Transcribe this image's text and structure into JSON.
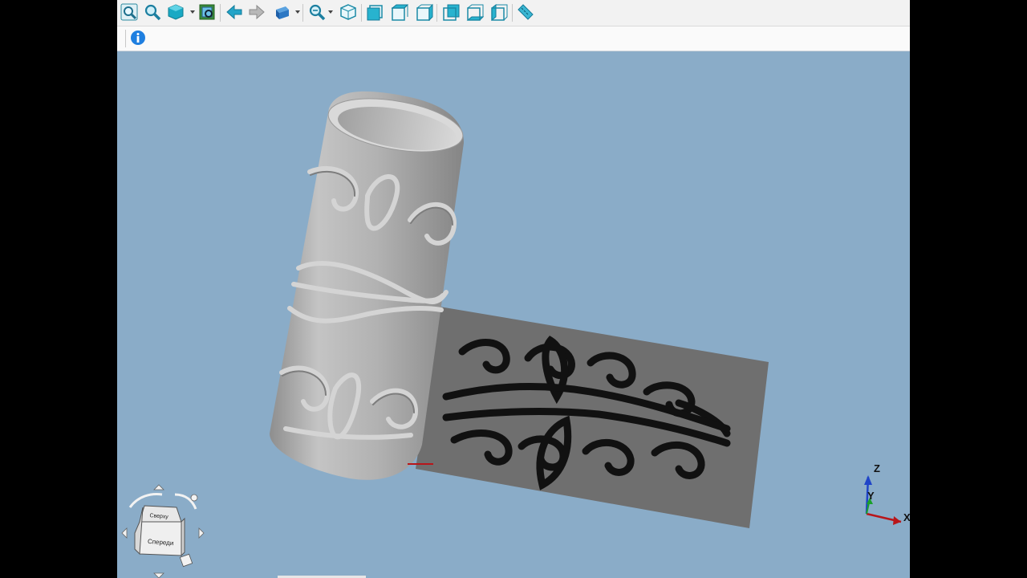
{
  "toolbar": {
    "buttons": [
      {
        "name": "zoom-fit-icon"
      },
      {
        "name": "zoom-window-icon"
      },
      {
        "name": "view-style-icon"
      },
      {
        "name": "render-mode-icon"
      },
      {
        "name": "back-arrow-icon"
      },
      {
        "name": "forward-arrow-icon"
      },
      {
        "name": "std-view-icon"
      },
      {
        "name": "zoom-in-icon"
      },
      {
        "name": "view-iso-icon"
      },
      {
        "name": "view-front-icon"
      },
      {
        "name": "view-top-icon"
      },
      {
        "name": "view-right-icon"
      },
      {
        "name": "view-rear-icon"
      },
      {
        "name": "view-bottom-icon"
      },
      {
        "name": "view-left-icon"
      },
      {
        "name": "measure-icon"
      }
    ],
    "info_icon": "info-icon"
  },
  "navigation_cube": {
    "top_face_label": "Сверху",
    "front_face_label": "Спереди"
  },
  "axes": {
    "x_label": "X",
    "y_label": "Y",
    "z_label": "Z",
    "x_color": "#b8161a",
    "y_color": "#19a02a",
    "z_color": "#1f44c8"
  },
  "colors": {
    "viewport_bg": "#8aacc8",
    "model_grey": "#a8a8a8",
    "relief_plate": "#6f6f6f"
  }
}
